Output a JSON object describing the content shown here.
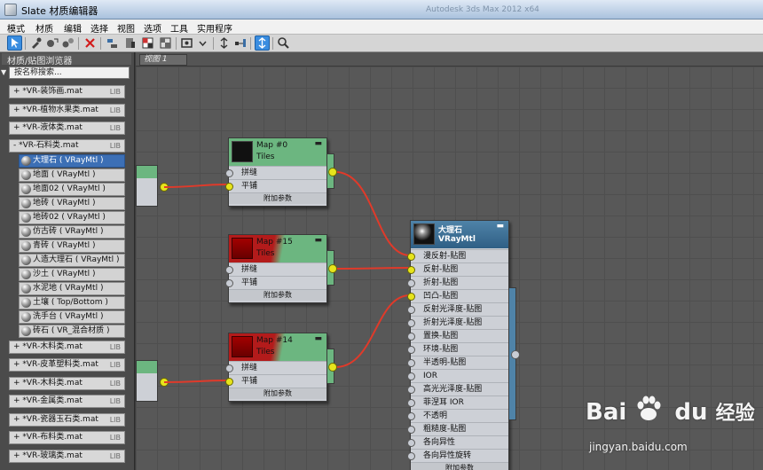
{
  "window": {
    "title": "Slate 材质编辑器",
    "faded_title": "Autodesk 3ds Max  2012 x64"
  },
  "menu": [
    "模式",
    "材质",
    "编辑",
    "选择",
    "视图",
    "选项",
    "工具",
    "实用程序"
  ],
  "left_panel": {
    "title": "材质/贴图浏览器",
    "search_placeholder": "按名称搜索...",
    "libraries_top": [
      {
        "label": "+ *VR-装饰画.mat",
        "tag": "LIB"
      },
      {
        "label": "+ *VR-植物水果类.mat",
        "tag": "LIB"
      },
      {
        "label": "+ *VR-液体类.mat",
        "tag": "LIB"
      },
      {
        "label": "- *VR-石料类.mat",
        "tag": "LIB"
      }
    ],
    "materials": [
      "大理石  ( VRayMtl )",
      "地面  ( VRayMtl )",
      "地面02  ( VRayMtl )",
      "地砖  ( VRayMtl )",
      "地砖02  ( VRayMtl )",
      "仿古砖  ( VRayMtl )",
      "青砖  ( VRayMtl )",
      "人造大理石  ( VRayMtl )",
      "沙土  ( VRayMtl )",
      "水泥地  ( VRayMtl )",
      "土壤  ( Top/Bottom )",
      "洗手台  ( VRayMtl )",
      "砖石  ( VR_混合材质 )"
    ],
    "libraries_bottom": [
      {
        "label": "+ *VR-木料类.mat",
        "tag": "LIB"
      },
      {
        "label": "+ *VR-皮革塑料类.mat",
        "tag": "LIB"
      },
      {
        "label": "+ *VR-木料类.mat",
        "tag": "LIB"
      },
      {
        "label": "+ *VR-金属类.mat",
        "tag": "LIB"
      },
      {
        "label": "+ *VR-瓷器玉石类.mat",
        "tag": "LIB"
      },
      {
        "label": "+ *VR-布料类.mat",
        "tag": "LIB"
      },
      {
        "label": "+ *VR-玻璃类.mat",
        "tag": "LIB"
      }
    ]
  },
  "view_tab": "视图 1",
  "nodes": {
    "map0": {
      "title": "Map #0",
      "subtitle": "Tiles",
      "rows": [
        "拼缝",
        "平铺"
      ],
      "footer": "附加参数"
    },
    "map15": {
      "title": "Map #15",
      "subtitle": "Tiles",
      "rows": [
        "拼缝",
        "平铺"
      ],
      "footer": "附加参数"
    },
    "map14": {
      "title": "Map #14",
      "subtitle": "Tiles",
      "rows": [
        "拼缝",
        "平铺"
      ],
      "footer": "附加参数"
    },
    "vray": {
      "title": "大理石",
      "subtitle": "VRayMtl",
      "rows": [
        "漫反射-贴图",
        "反射-贴图",
        "折射-贴图",
        "凹凸-贴图",
        "反射光泽度-贴图",
        "折射光泽度-贴图",
        "置换-贴图",
        "环境-贴图",
        "半透明-贴图",
        "IOR",
        "高光光泽度-贴图",
        "菲涅耳 IOR",
        "不透明",
        "粗糙度-贴图",
        "各向异性",
        "各向异性旋转"
      ],
      "footer": "附加参数"
    }
  },
  "watermark": {
    "brand": "Bai",
    "brand_tail": "du",
    "brand_cn": "经验",
    "url": "jingyan.baidu.com"
  },
  "colors": {
    "node_green": "#6cb680",
    "socket_yellow": "#e7e41c",
    "wire_red": "#e03a2a",
    "selection_blue": "#3c6fb5"
  }
}
